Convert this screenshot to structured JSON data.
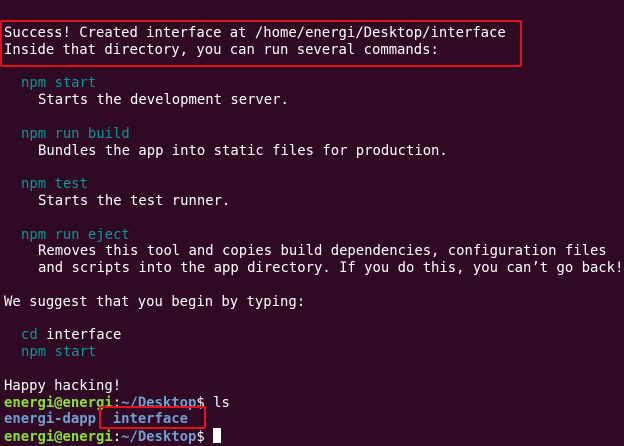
{
  "success_block": {
    "line1": "Success! Created interface at /home/energi/Desktop/interface",
    "line2": "Inside that directory, you can run several commands:"
  },
  "commands": [
    {
      "cmd": "npm start",
      "desc": [
        "Starts the development server."
      ]
    },
    {
      "cmd": "npm run build",
      "desc": [
        "Bundles the app into static files for production."
      ]
    },
    {
      "cmd": "npm test",
      "desc": [
        "Starts the test runner."
      ]
    },
    {
      "cmd": "npm run eject",
      "desc": [
        "Removes this tool and copies build dependencies, configuration files",
        "and scripts into the app directory. If you do this, you can’t go back!"
      ]
    }
  ],
  "suggest_text": "We suggest that you begin by typing:",
  "suggest_cmds": {
    "cd": "cd",
    "cd_arg": "interface",
    "start": "npm start"
  },
  "happy_text": "Happy hacking!",
  "prompt": {
    "user_host": "energi@energi",
    "colon": ":",
    "path": "~/Desktop",
    "dollar": "$",
    "ls_command": "ls"
  },
  "ls_output": {
    "item1": "energi-dapp",
    "item2": "interface"
  },
  "colors": {
    "background": "#300a24",
    "command_teal": "#06989a",
    "prompt_green": "#8ae234",
    "path_blue": "#729fcf",
    "highlight_red": "#e0121f"
  }
}
